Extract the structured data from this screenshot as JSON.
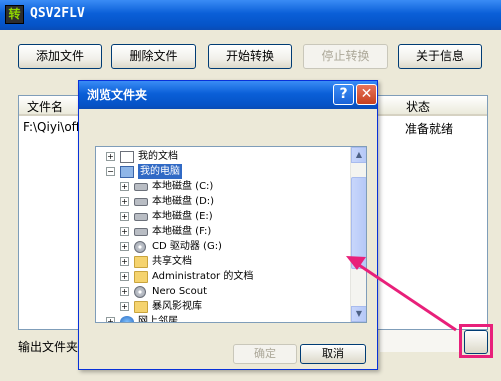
{
  "main_window": {
    "title": "QSV2FLV",
    "app_icon_glyph": "转",
    "toolbar": {
      "add": "添加文件",
      "delete": "删除文件",
      "start": "开始转换",
      "stop": "停止转换",
      "about": "关于信息"
    },
    "file_list": {
      "col_filename": "文件名",
      "col_status": "状态",
      "rows": [
        {
          "filename": "F:\\Qiyi\\offl",
          "status": "准备就绪"
        }
      ]
    },
    "output_label": "输出文件夹"
  },
  "dialog": {
    "title": "浏览文件夹",
    "help_glyph": "?",
    "close_glyph": "✕",
    "ok": "确定",
    "cancel": "取消",
    "tree": [
      {
        "label": "我的文档",
        "icon": "docs-icon",
        "expander": "+"
      },
      {
        "label": "我的电脑",
        "icon": "computer-icon",
        "expander": "−",
        "selected": true
      },
      {
        "label": "本地磁盘 (C:)",
        "icon": "drive-icon",
        "expander": "+"
      },
      {
        "label": "本地磁盘 (D:)",
        "icon": "drive-icon",
        "expander": "+"
      },
      {
        "label": "本地磁盘 (E:)",
        "icon": "drive-icon",
        "expander": "+"
      },
      {
        "label": "本地磁盘 (F:)",
        "icon": "drive-icon",
        "expander": "+"
      },
      {
        "label": "CD 驱动器 (G:)",
        "icon": "cd-icon",
        "expander": "+"
      },
      {
        "label": "共享文档",
        "icon": "folder-icon",
        "expander": "+"
      },
      {
        "label": "Administrator 的文档",
        "icon": "folder-icon",
        "expander": "+"
      },
      {
        "label": "Nero Scout",
        "icon": "nero-icon",
        "expander": "+"
      },
      {
        "label": "暴风影视库",
        "icon": "folder-icon",
        "expander": "+"
      },
      {
        "label": "网上邻居",
        "icon": "network-icon",
        "expander": "+"
      }
    ],
    "scroll_up": "▲",
    "scroll_down": "▼"
  },
  "colors": {
    "title_blue": "#0a5fd8",
    "annotation_pink": "#e8207a",
    "selection_blue": "#316ac5"
  }
}
